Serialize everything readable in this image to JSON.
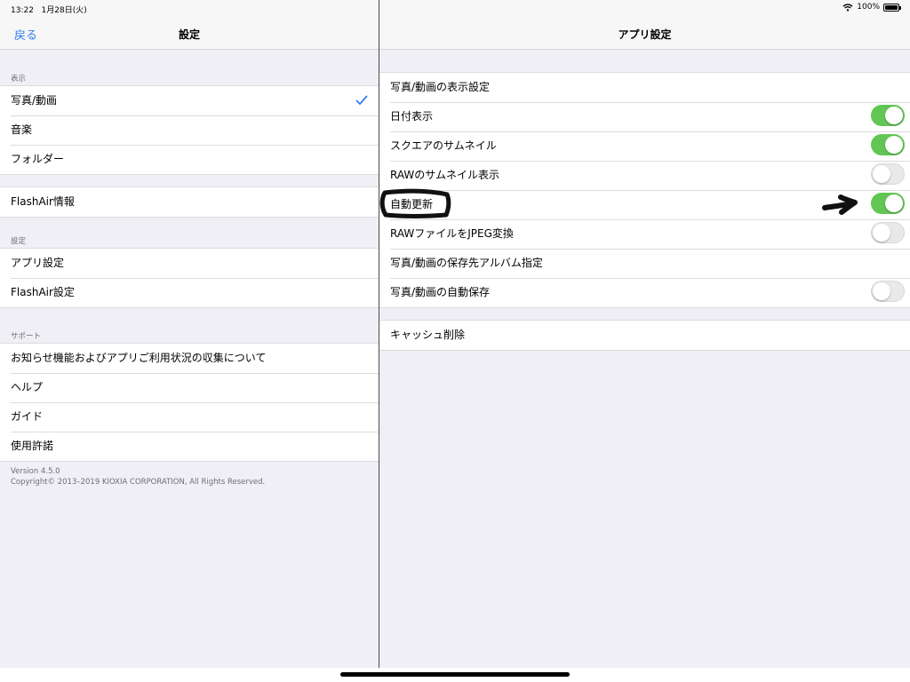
{
  "status": {
    "time": "13:22",
    "date": "1月28日(火)",
    "battery": "100%"
  },
  "left": {
    "back_label": "戻る",
    "title": "設定",
    "sections": [
      {
        "header": "表示",
        "items": [
          {
            "label": "写真/動画",
            "checked": true
          },
          {
            "label": "音楽"
          },
          {
            "label": "フォルダー"
          }
        ]
      },
      {
        "header": "",
        "items": [
          {
            "label": "FlashAir情報"
          }
        ]
      },
      {
        "header": "設定",
        "items": [
          {
            "label": "アプリ設定"
          },
          {
            "label": "FlashAir設定"
          }
        ]
      },
      {
        "header": "サポート",
        "items": [
          {
            "label": "お知らせ機能およびアプリご利用状況の収集について"
          },
          {
            "label": "ヘルプ"
          },
          {
            "label": "ガイド"
          },
          {
            "label": "使用許諾"
          }
        ]
      }
    ],
    "footer": {
      "version": "Version 4.5.0",
      "copyright": "Copyright© 2013–2019 KIOXIA CORPORATION, All Rights Reserved."
    }
  },
  "right": {
    "title": "アプリ設定",
    "items": [
      {
        "label": "写真/動画の表示設定"
      },
      {
        "label": "日付表示",
        "toggle": true
      },
      {
        "label": "スクエアのサムネイル",
        "toggle": true
      },
      {
        "label": "RAWのサムネイル表示",
        "toggle": false
      },
      {
        "label": "自動更新",
        "toggle": true
      },
      {
        "label": "RAWファイルをJPEG変換",
        "toggle": false
      },
      {
        "label": "写真/動画の保存先アルバム指定"
      },
      {
        "label": "写真/動画の自動保存",
        "toggle": false
      }
    ],
    "cache": {
      "label": "キャッシュ削除"
    }
  },
  "colors": {
    "accent": "#2f7df6",
    "toggle_on": "#62c655",
    "toggle_off": "#e9e9eb",
    "background": "#f0eff5"
  }
}
